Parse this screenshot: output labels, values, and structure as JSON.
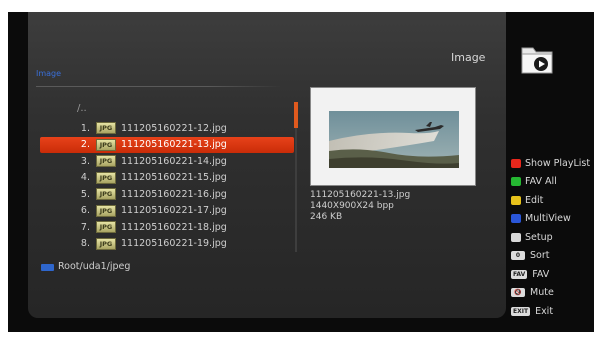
{
  "header": {
    "title": "Image",
    "folder_icon": "folder-play-icon"
  },
  "breadcrumb": "Image",
  "browser": {
    "parent_label": "/..",
    "file_badge": "JPG",
    "files": [
      {
        "num": "1.",
        "name": "111205160221-12.jpg",
        "selected": false
      },
      {
        "num": "2.",
        "name": "111205160221-13.jpg",
        "selected": true
      },
      {
        "num": "3.",
        "name": "111205160221-14.jpg",
        "selected": false
      },
      {
        "num": "4.",
        "name": "111205160221-15.jpg",
        "selected": false
      },
      {
        "num": "5.",
        "name": "111205160221-16.jpg",
        "selected": false
      },
      {
        "num": "6.",
        "name": "111205160221-17.jpg",
        "selected": false
      },
      {
        "num": "7.",
        "name": "111205160221-18.jpg",
        "selected": false
      },
      {
        "num": "8.",
        "name": "111205160221-19.jpg",
        "selected": false
      }
    ],
    "path": "Root/uda1/jpeg"
  },
  "preview": {
    "filename": "111205160221-13.jpg",
    "resolution": "1440X900X24 bpp",
    "size": "246 KB"
  },
  "legend": [
    {
      "kind": "color",
      "color": "#e8271c",
      "label": "Show PlayList"
    },
    {
      "kind": "color",
      "color": "#25b832",
      "label": "FAV All"
    },
    {
      "kind": "color",
      "color": "#e7c21b",
      "label": "Edit"
    },
    {
      "kind": "color",
      "color": "#2a56d8",
      "label": "MultiView"
    },
    {
      "kind": "color",
      "color": "#d8d8d8",
      "label": "Setup"
    },
    {
      "kind": "key",
      "key": "0",
      "label": "Sort"
    },
    {
      "kind": "key",
      "key": "FAV",
      "label": "FAV"
    },
    {
      "kind": "key",
      "key": "🔇",
      "label": "Mute"
    },
    {
      "kind": "key",
      "key": "EXIT",
      "label": "Exit"
    }
  ]
}
